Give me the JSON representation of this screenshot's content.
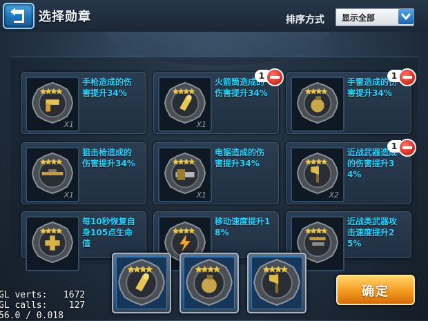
{
  "header": {
    "title": "选择勋章",
    "sort_label": "排序方式",
    "sort_value": "显示全部"
  },
  "cards": [
    {
      "desc": "手枪造成的伤害提升34%",
      "qty": "X1",
      "icon": "pistol-icon",
      "selected_count": null
    },
    {
      "desc": "火箭筒造成的伤害提升34%",
      "qty": "X1",
      "icon": "rocket-shell-icon",
      "selected_count": "1"
    },
    {
      "desc": "手雷造成的伤害提升34%",
      "qty": "",
      "icon": "grenade-icon",
      "selected_count": "1"
    },
    {
      "desc": "狙击枪造成的伤害提升34%",
      "qty": "X1",
      "icon": "sniper-rifle-icon",
      "selected_count": null
    },
    {
      "desc": "电锯造成的伤害提升34%",
      "qty": "X1",
      "icon": "chainsaw-icon",
      "selected_count": null
    },
    {
      "desc": "近战武器造成的伤害提升34%",
      "qty": "X2",
      "icon": "axe-icon",
      "selected_count": "1"
    },
    {
      "desc": "每10秒恢复自身105点生命值",
      "qty": "",
      "icon": "health-cross-icon",
      "selected_count": null
    },
    {
      "desc": "移动速度提升18%",
      "qty": "",
      "icon": "speed-bolt-icon",
      "selected_count": null
    },
    {
      "desc": "近战类武器攻击速度提升25%",
      "qty": "",
      "icon": "melee-weapons-icon",
      "selected_count": null
    }
  ],
  "selected_medals": [
    {
      "icon": "rocket-shell-icon"
    },
    {
      "icon": "grenade-icon"
    },
    {
      "icon": "axe-icon"
    }
  ],
  "confirm_label": "确定",
  "debug": {
    "line1": "GL verts:   1672",
    "line2": "GL calls:    127",
    "line3": "56.0 / 0.018"
  },
  "colors": {
    "desc_text": "#26d3ff",
    "confirm": "#f59a1f",
    "remove": "#d2261b",
    "back": "#1f6fb3"
  }
}
